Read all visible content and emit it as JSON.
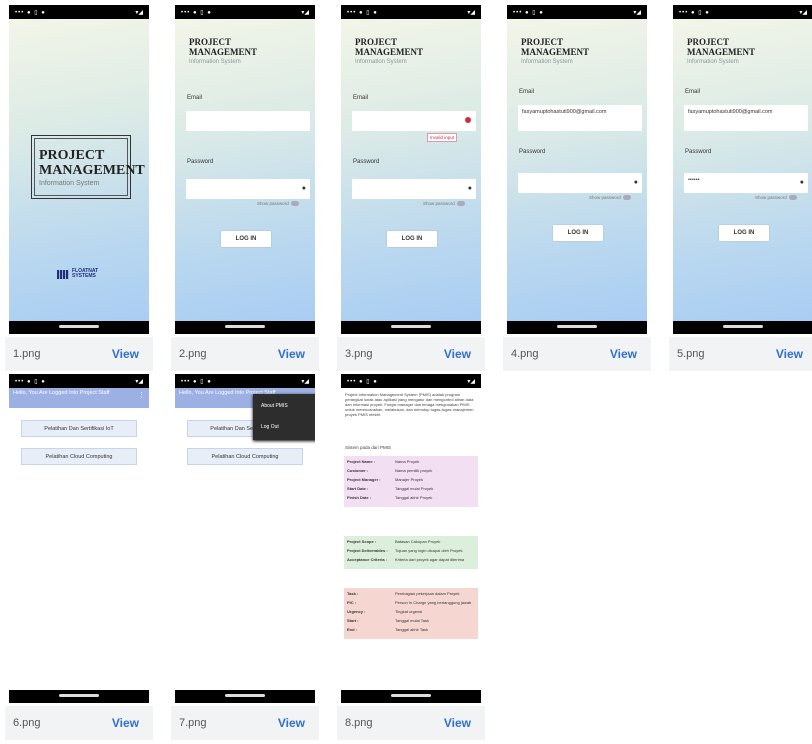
{
  "status_bar": {
    "left": "••• ● ▯ ●",
    "right": "▾◢"
  },
  "cards": [
    {
      "filename": "1.png",
      "view": "View"
    },
    {
      "filename": "2.png",
      "view": "View"
    },
    {
      "filename": "3.png",
      "view": "View"
    },
    {
      "filename": "4.png",
      "view": "View"
    },
    {
      "filename": "5.png",
      "view": "View"
    },
    {
      "filename": "6.png",
      "view": "View"
    },
    {
      "filename": "7.png",
      "view": "View"
    },
    {
      "filename": "8.png",
      "view": "View"
    }
  ],
  "splash": {
    "title_line1": "PROJECT",
    "title_line2": "MANAGEMENT",
    "subtitle": "Information System",
    "logo_line1": "FLOATNAT",
    "logo_line2": "SYSTEMS"
  },
  "login": {
    "title_line1": "PROJECT",
    "title_line2": "MANAGEMENT",
    "subtitle": "Information System",
    "email_label": "Email",
    "password_label": "Password",
    "show_password": "Show password",
    "login_button": "LOG IN",
    "error_tip": "Invalid input",
    "email_value_4": "fasyamuptohastuti900@gmail.com",
    "email_value_5": "fasyamuptohastuti900@gmail.com",
    "password_value_5": "••••••"
  },
  "menu": {
    "appbar_text": "Hello, You Are Logged Into Project Staff",
    "more_icon": "⋮",
    "item1": "Pelatihan Dan Sertifikasi IoT",
    "item2": "Pelatihan Cloud Computing",
    "popup_item1": "About PMIS",
    "popup_item2": "Log Out"
  },
  "detail": {
    "paragraph": "Project Information Management System (PMIS) adalah program perangkat lunak atau aplikasi yang mengatur dan mengontrol aliran data dan informasi proyek. Fungsi manager dan tenaga mengunakan PMIS untuk merencanakan, melakukan, dan menutup tugas-tugas manajemen proyek PMIS efektif.",
    "small_line": "Sistem pada dari PMIS",
    "panel1": [
      [
        "Project Name :",
        "Nama Proyek"
      ],
      [
        "Customer :",
        "Nama pemilik proyek"
      ],
      [
        "Project Manager :",
        "Manajer Proyek"
      ],
      [
        "Start Date :",
        "Tanggal mulai Proyek"
      ],
      [
        "Finish Date :",
        "Tanggal akhir Proyek"
      ]
    ],
    "panel2": [
      [
        "Project Scope :",
        "Batasan Cakupan Proyek"
      ],
      [
        "Project Deliverables :",
        "Tujuan yang ingin dicapai oleh Proyek"
      ],
      [
        "Acceptance Criteria :",
        "Kriteria dari proyek agar dapat diterima"
      ]
    ],
    "panel3": [
      [
        "Task :",
        "Pembagian pekerjaan dalam Proyek"
      ],
      [
        "PIC :",
        "Person In Charge yang bertanggung jawab"
      ],
      [
        "Urgency :",
        "Tingkat urgensi"
      ],
      [
        "Start :",
        "Tanggal mulai Task"
      ],
      [
        "End :",
        "Tanggal akhir Task"
      ]
    ],
    "panel_colors": [
      "#f2dff2",
      "#dcefdc",
      "#f6d6d0"
    ]
  }
}
